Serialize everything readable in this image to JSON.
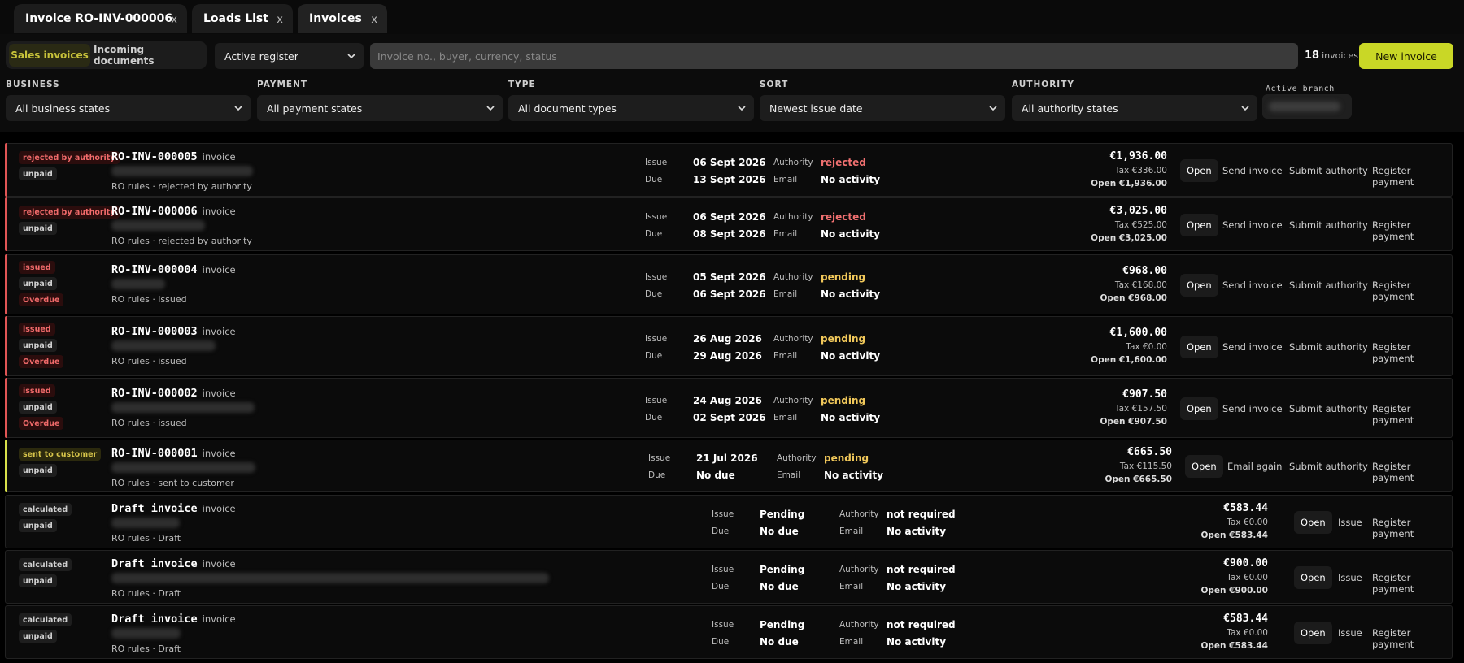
{
  "tabs": [
    {
      "label": "Invoice RO-INV-000006",
      "close": "x"
    },
    {
      "label": "Loads List",
      "close": "x"
    },
    {
      "label": "Invoices",
      "close": "x"
    }
  ],
  "segments": {
    "sales": "Sales invoices",
    "incoming": "Incoming documents"
  },
  "register": {
    "value": "Active register"
  },
  "search": {
    "placeholder": "Invoice no., buyer, currency, status"
  },
  "count": {
    "number": "18",
    "label": "invoices"
  },
  "new_invoice": "New invoice",
  "filters": {
    "business": {
      "label": "BUSINESS",
      "value": "All business states"
    },
    "payment": {
      "label": "PAYMENT",
      "value": "All payment states"
    },
    "type": {
      "label": "TYPE",
      "value": "All document types"
    },
    "sort": {
      "label": "SORT",
      "value": "Newest issue date"
    },
    "authority": {
      "label": "AUTHORITY",
      "value": "All authority states"
    },
    "branch": {
      "label": "Active branch"
    }
  },
  "field_labels": {
    "issue": "Issue",
    "due": "Due",
    "authority": "Authority",
    "email": "Email"
  },
  "colors": {
    "accent_red": "#e05555",
    "accent_yellow": "#d8e04a",
    "new_button": "#c9d726"
  },
  "invoices": [
    {
      "badges": [
        "rejected by authority",
        "unpaid"
      ],
      "number": "RO-INV-000005",
      "kind": "invoice",
      "rules": "RO rules · rejected by authority",
      "issue": "06 Sept 2026",
      "due": "13 Sept 2026",
      "authority": "rejected",
      "email": "No activity",
      "total": "€1,936.00",
      "tax": "Tax €336.00",
      "open": "Open €1,936.00",
      "actions": [
        "Open",
        "Send invoice",
        "Submit authority",
        "Register payment"
      ]
    },
    {
      "badges": [
        "rejected by authority",
        "unpaid"
      ],
      "number": "RO-INV-000006",
      "kind": "invoice",
      "rules": "RO rules · rejected by authority",
      "issue": "06 Sept 2026",
      "due": "08 Sept 2026",
      "authority": "rejected",
      "email": "No activity",
      "total": "€3,025.00",
      "tax": "Tax €525.00",
      "open": "Open €3,025.00",
      "actions": [
        "Open",
        "Send invoice",
        "Submit authority",
        "Register payment"
      ]
    },
    {
      "badges": [
        "issued",
        "unpaid",
        "Overdue"
      ],
      "number": "RO-INV-000004",
      "kind": "invoice",
      "rules": "RO rules · issued",
      "issue": "05 Sept 2026",
      "due": "06 Sept 2026",
      "authority": "pending",
      "email": "No activity",
      "total": "€968.00",
      "tax": "Tax €168.00",
      "open": "Open €968.00",
      "actions": [
        "Open",
        "Send invoice",
        "Submit authority",
        "Register payment"
      ]
    },
    {
      "badges": [
        "issued",
        "unpaid",
        "Overdue"
      ],
      "number": "RO-INV-000003",
      "kind": "invoice",
      "rules": "RO rules · issued",
      "issue": "26 Aug 2026",
      "due": "29 Aug 2026",
      "authority": "pending",
      "email": "No activity",
      "total": "€1,600.00",
      "tax": "Tax €0.00",
      "open": "Open €1,600.00",
      "actions": [
        "Open",
        "Send invoice",
        "Submit authority",
        "Register payment"
      ]
    },
    {
      "badges": [
        "issued",
        "unpaid",
        "Overdue"
      ],
      "number": "RO-INV-000002",
      "kind": "invoice",
      "rules": "RO rules · issued",
      "issue": "24 Aug 2026",
      "due": "02 Sept 2026",
      "authority": "pending",
      "email": "No activity",
      "total": "€907.50",
      "tax": "Tax €157.50",
      "open": "Open €907.50",
      "actions": [
        "Open",
        "Send invoice",
        "Submit authority",
        "Register payment"
      ]
    },
    {
      "badges": [
        "sent to customer",
        "unpaid"
      ],
      "number": "RO-INV-000001",
      "kind": "invoice",
      "rules": "RO rules · sent to customer",
      "issue": "21 Jul 2026",
      "due": "No due",
      "authority": "pending",
      "email": "No activity",
      "total": "€665.50",
      "tax": "Tax €115.50",
      "open": "Open €665.50",
      "actions": [
        "Open",
        "Email again",
        "Submit authority",
        "Register payment"
      ]
    },
    {
      "badges": [
        "calculated",
        "unpaid"
      ],
      "number": "Draft invoice",
      "kind": "invoice",
      "rules": "RO rules · Draft",
      "issue": "Pending",
      "due": "No due",
      "authority": "not required",
      "email": "No activity",
      "total": "€583.44",
      "tax": "Tax €0.00",
      "open": "Open €583.44",
      "actions": [
        "Open",
        "Issue",
        "Register payment"
      ]
    },
    {
      "badges": [
        "calculated",
        "unpaid"
      ],
      "number": "Draft invoice",
      "kind": "invoice",
      "rules": "RO rules · Draft",
      "issue": "Pending",
      "due": "No due",
      "authority": "not required",
      "email": "No activity",
      "total": "€900.00",
      "tax": "Tax €0.00",
      "open": "Open €900.00",
      "actions": [
        "Open",
        "Issue",
        "Register payment"
      ]
    },
    {
      "badges": [
        "calculated",
        "unpaid"
      ],
      "number": "Draft invoice",
      "kind": "invoice",
      "rules": "RO rules · Draft",
      "issue": "Pending",
      "due": "No due",
      "authority": "not required",
      "email": "No activity",
      "total": "€583.44",
      "tax": "Tax €0.00",
      "open": "Open €583.44",
      "actions": [
        "Open",
        "Issue",
        "Register payment"
      ]
    }
  ]
}
